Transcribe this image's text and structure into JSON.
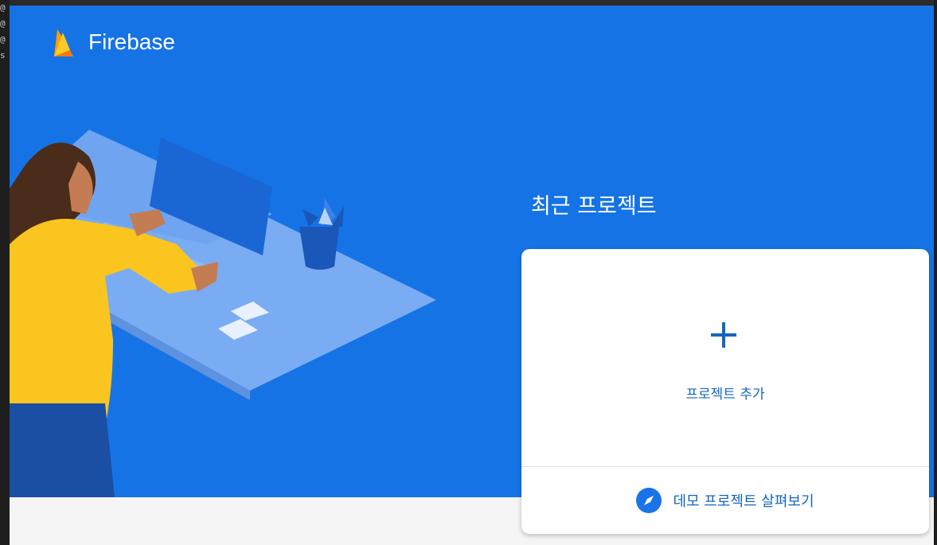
{
  "terminal": {
    "glyphs": [
      "@",
      "@",
      "@",
      "s"
    ]
  },
  "header": {
    "brand": "Firebase",
    "logo_icon": "firebase-flame-icon"
  },
  "main": {
    "recent_projects_title": "최근 프로젝트"
  },
  "add_project_card": {
    "label": "프로젝트 추가",
    "icon": "plus-icon"
  },
  "demo": {
    "label": "데모 프로젝트 살펴보기",
    "icon": "compass-icon"
  },
  "colors": {
    "hero_bg": "#1573e6",
    "accent": "#1565c0",
    "flame_yellow": "#ffca28",
    "flame_orange": "#ffa000"
  }
}
